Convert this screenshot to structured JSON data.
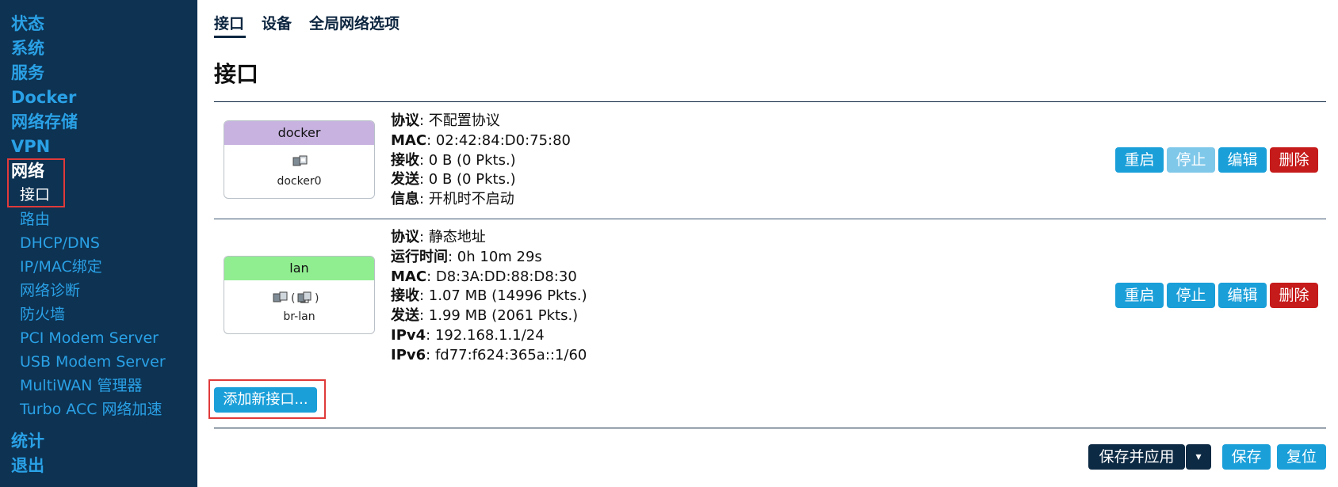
{
  "sidebar": {
    "top_items": [
      "状态",
      "系统",
      "服务",
      "Docker",
      "网络存储",
      "VPN",
      "网络"
    ],
    "network_sub": [
      "接口",
      "路由",
      "DHCP/DNS",
      "IP/MAC绑定",
      "网络诊断",
      "防火墙",
      "PCI Modem Server",
      "USB Modem Server",
      "MultiWAN 管理器",
      "Turbo ACC 网络加速"
    ],
    "bottom_items": [
      "统计",
      "退出"
    ]
  },
  "tabs": [
    "接口",
    "设备",
    "全局网络选项"
  ],
  "page_title": "接口",
  "interfaces": [
    {
      "name": "docker",
      "head_color": "#c8b3e0",
      "icon": "ethernet-port-icon",
      "device": "docker0",
      "rows": [
        {
          "k": "协议",
          "v": ": 不配置协议"
        },
        {
          "k": "MAC",
          "v": ": 02:42:84:D0:75:80"
        },
        {
          "k": "接收",
          "v": ": 0 B (0 Pkts.)"
        },
        {
          "k": "发送",
          "v": ": 0 B (0 Pkts.)"
        },
        {
          "k": "信息",
          "v": ": 开机时不启动"
        }
      ],
      "actions": [
        "重启",
        "停止",
        "编辑",
        "删除"
      ]
    },
    {
      "name": "lan",
      "head_color": "#90ee90",
      "icon": "ethernet-port-icon",
      "icon2": "bridge-port-icon",
      "device": "br-lan",
      "rows": [
        {
          "k": "协议",
          "v": ": 静态地址"
        },
        {
          "k": "运行时间",
          "v": ": 0h 10m 29s"
        },
        {
          "k": "MAC",
          "v": ": D8:3A:DD:88:D8:30"
        },
        {
          "k": "接收",
          "v": ": 1.07 MB (14996 Pkts.)"
        },
        {
          "k": "发送",
          "v": ": 1.99 MB (2061 Pkts.)"
        },
        {
          "k": "IPv4",
          "v": ": 192.168.1.1/24"
        },
        {
          "k": "IPv6",
          "v": ": fd77:f624:365a::1/60"
        }
      ],
      "actions": [
        "重启",
        "停止",
        "编辑",
        "删除"
      ]
    }
  ],
  "add_interface_label": "添加新接口...",
  "footer": {
    "save_apply": "保存并应用",
    "dropdown": "▾",
    "save": "保存",
    "reset": "复位"
  },
  "colors": {
    "sidebar_bg": "#0d3252",
    "accent": "#1a9fd9",
    "danger": "#c61b1b",
    "highlight": "#e03a3a"
  }
}
